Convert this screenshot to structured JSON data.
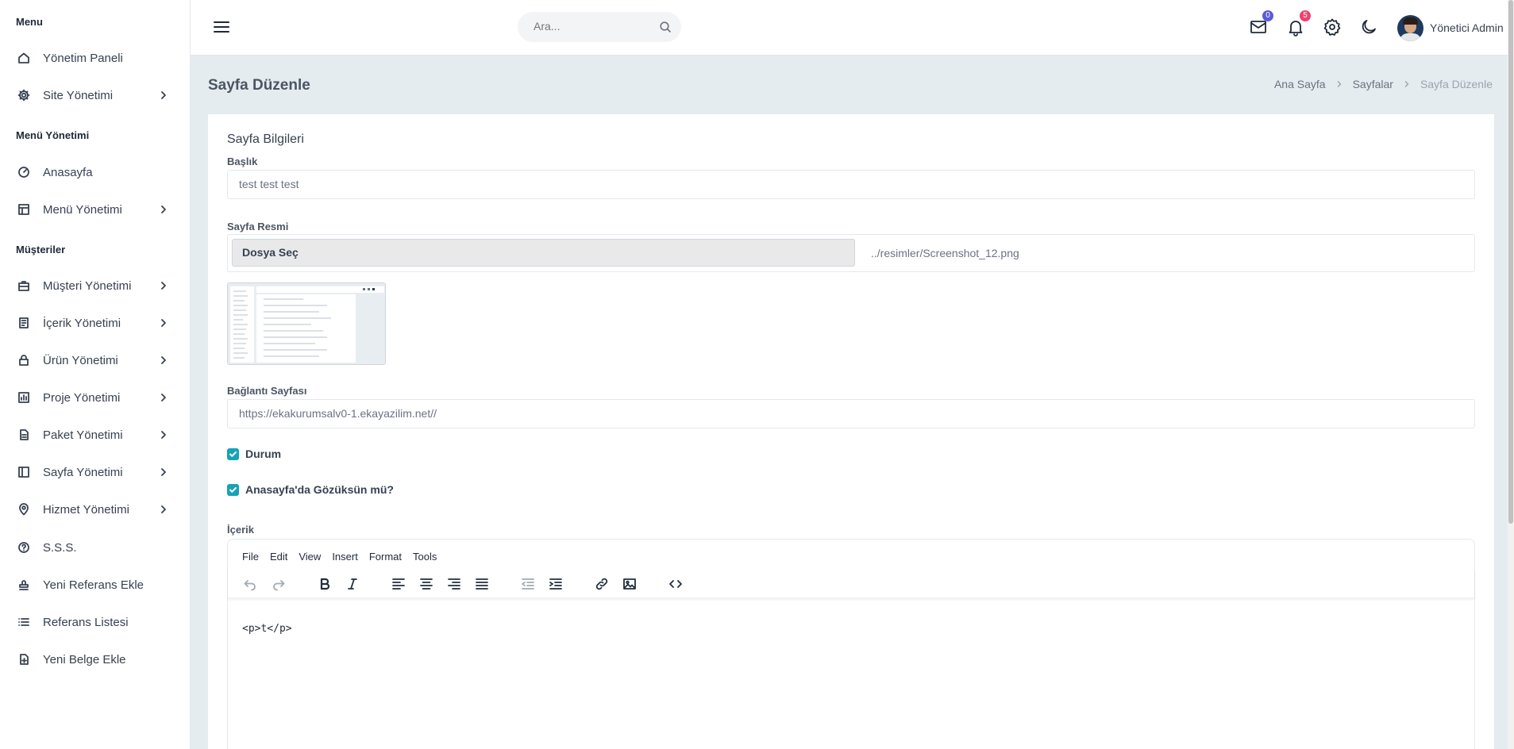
{
  "sidebar": {
    "sections": [
      {
        "title": "Menu"
      },
      {
        "title": "Menü Yönetimi"
      },
      {
        "title": "Müşteriler"
      }
    ],
    "items": [
      {
        "label": "Yönetim Paneli",
        "icon": "home-icon"
      },
      {
        "label": "Site Yönetimi",
        "icon": "gear-icon"
      },
      {
        "label": "Anasayfa",
        "icon": "dashboard-icon"
      },
      {
        "label": "Menü Yönetimi",
        "icon": "layout-icon"
      },
      {
        "label": "Müşteri Yönetimi",
        "icon": "briefcase-icon"
      },
      {
        "label": "İçerik Yönetimi",
        "icon": "document-icon"
      },
      {
        "label": "Ürün Yönetimi",
        "icon": "lock-icon"
      },
      {
        "label": "Proje Yönetimi",
        "icon": "chart-icon"
      },
      {
        "label": "Paket Yönetimi",
        "icon": "file-icon"
      },
      {
        "label": "Sayfa Yönetimi",
        "icon": "sidebar-layout-icon"
      },
      {
        "label": "Hizmet Yönetimi",
        "icon": "location-pin-icon"
      },
      {
        "label": "S.S.S.",
        "icon": "question-circle-icon"
      },
      {
        "label": "Yeni Referans Ekle",
        "icon": "stamp-icon"
      },
      {
        "label": "Referans Listesi",
        "icon": "list-icon"
      },
      {
        "label": "Yeni Belge Ekle",
        "icon": "file-plus-icon"
      }
    ]
  },
  "topbar": {
    "search_placeholder": "Ara...",
    "mail_count": "0",
    "notification_count": "5",
    "user_name": "Yönetici Admin"
  },
  "page": {
    "title": "Sayfa Düzenle",
    "breadcrumb": [
      "Ana Sayfa",
      "Sayfalar",
      "Sayfa Düzenle"
    ]
  },
  "form": {
    "card_title": "Sayfa Bilgileri",
    "title_label": "Başlık",
    "title_value": "test test test",
    "image_label": "Sayfa Resmi",
    "file_button": "Dosya Seç",
    "file_name": "../resimler/Screenshot_12.png",
    "link_label": "Bağlantı Sayfası",
    "link_value": "https://ekakurumsalv0-1.ekayazilim.net//",
    "status_label": "Durum",
    "show_home_label": "Anasayfa'da Gözüksün mü?",
    "content_label": "İçerik"
  },
  "editor": {
    "menu": [
      "File",
      "Edit",
      "View",
      "Insert",
      "Format",
      "Tools"
    ],
    "body": "<p>t</p>"
  },
  "colors": {
    "accent": "#17a2b8",
    "mail_badge": "#5b5bd6",
    "notification_badge": "#f0416c",
    "content_bg": "#e5ecef"
  }
}
